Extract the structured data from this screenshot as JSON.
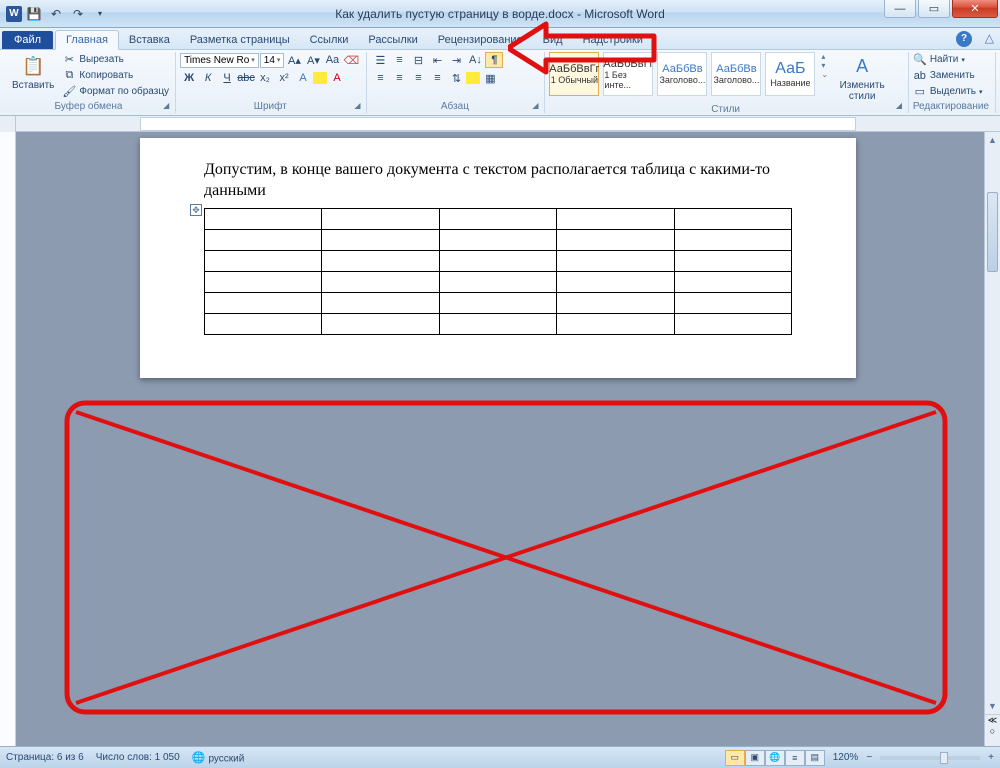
{
  "window": {
    "title": "Как удалить пустую страницу в ворде.docx - Microsoft Word"
  },
  "tabs": {
    "file": "Файл",
    "items": [
      "Главная",
      "Вставка",
      "Разметка страницы",
      "Ссылки",
      "Рассылки",
      "Рецензирование",
      "Вид",
      "Надстройки"
    ]
  },
  "clipboard": {
    "paste": "Вставить",
    "cut": "Вырезать",
    "copy": "Копировать",
    "format_painter": "Формат по образцу",
    "group": "Буфер обмена"
  },
  "font": {
    "name": "Times New Ro",
    "size": "14",
    "group": "Шрифт"
  },
  "paragraph": {
    "group": "Абзац"
  },
  "styles": {
    "group": "Стили",
    "items": [
      {
        "sample": "АаБбВвГг",
        "label": "1 Обычный"
      },
      {
        "sample": "АаБбВвГг",
        "label": "1 Без инте..."
      },
      {
        "sample": "АаБбВв",
        "label": "Заголово..."
      },
      {
        "sample": "АаБбВв",
        "label": "Заголово..."
      },
      {
        "sample": "АаБ",
        "label": "Название"
      }
    ],
    "change": "Изменить стили"
  },
  "editing": {
    "find": "Найти",
    "replace": "Заменить",
    "select": "Выделить",
    "group": "Редактирование"
  },
  "document": {
    "paragraph_text": "Допустим, в конце вашего документа с текстом располагается таблица с какими-то данными"
  },
  "status": {
    "page": "Страница: 6 из 6",
    "words": "Число слов: 1 050",
    "lang": "русский",
    "zoom": "120%"
  }
}
